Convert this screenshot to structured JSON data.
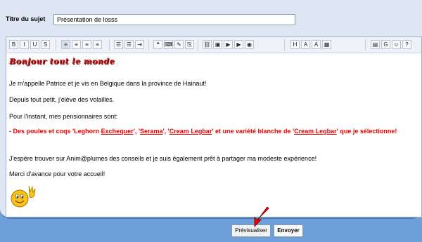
{
  "subject": {
    "label": "Titre du sujet",
    "value": "Présentation de losss"
  },
  "toolbar": {
    "buttons": [
      {
        "name": "bold-button",
        "glyph": "B"
      },
      {
        "name": "italic-button",
        "glyph": "I"
      },
      {
        "name": "underline-button",
        "glyph": "U"
      },
      {
        "name": "strikethrough-button",
        "glyph": "S"
      },
      {
        "name": "align-left-button",
        "glyph": "≡"
      },
      {
        "name": "align-center-button",
        "glyph": "≡"
      },
      {
        "name": "align-right-button",
        "glyph": "≡"
      },
      {
        "name": "justify-button",
        "glyph": "≡"
      },
      {
        "name": "bulleted-list-button",
        "glyph": "☰"
      },
      {
        "name": "numbered-list-button",
        "glyph": "☰"
      },
      {
        "name": "indent-button",
        "glyph": "⇥"
      },
      {
        "name": "quote-button",
        "glyph": "❝"
      },
      {
        "name": "code-button",
        "glyph": "⌨"
      },
      {
        "name": "spoiler-button",
        "glyph": "✎"
      },
      {
        "name": "hide-button",
        "glyph": "⎘"
      },
      {
        "name": "link-button",
        "glyph": "⛓"
      },
      {
        "name": "image-button",
        "glyph": "▣"
      },
      {
        "name": "video-button",
        "glyph": "▶"
      },
      {
        "name": "youtube-button",
        "glyph": "▶"
      },
      {
        "name": "flash-button",
        "glyph": "◉"
      },
      {
        "name": "font-size-button",
        "glyph": "H"
      },
      {
        "name": "font-family-button",
        "glyph": "A"
      },
      {
        "name": "font-color-button",
        "glyph": "A"
      },
      {
        "name": "table-button",
        "glyph": "▦"
      },
      {
        "name": "date-button",
        "glyph": "▤"
      },
      {
        "name": "google-button",
        "glyph": "G"
      },
      {
        "name": "smiley-button",
        "glyph": "☺"
      },
      {
        "name": "help-button",
        "glyph": "?"
      }
    ]
  },
  "message": {
    "greeting": "Bonjour tout le monde",
    "p1": "Je m'appelle Patrice et je vis en Belgique dans la province de Hainaut!",
    "p2": "Depuis tout petit, j'élève des volailles.",
    "p3": "Pour l'instant, mes pensionnaires sont:",
    "p4_a": "- Des poules et coqs 'Leghorn ",
    "p4_b": "Exchequer",
    "p4_c": "', '",
    "p4_d": "Serama",
    "p4_e": "', '",
    "p4_f": "Cream Legbar",
    "p4_g": "' et une variété blanche de '",
    "p4_h": "Cream Legbar",
    "p4_i": "' que je sélectionne!",
    "p5": "J'espère trouver sur Anim@plumes des conseils et je suis également prêt à partager ma modeste expérience!",
    "p6": "Merci d'avance pour votre accueil!"
  },
  "actions": {
    "preview_label": "Prévisualiser",
    "send_label": "Envoyer"
  },
  "colors": {
    "accent_red": "#e00000",
    "frame_blue": "#6f9fd8"
  }
}
